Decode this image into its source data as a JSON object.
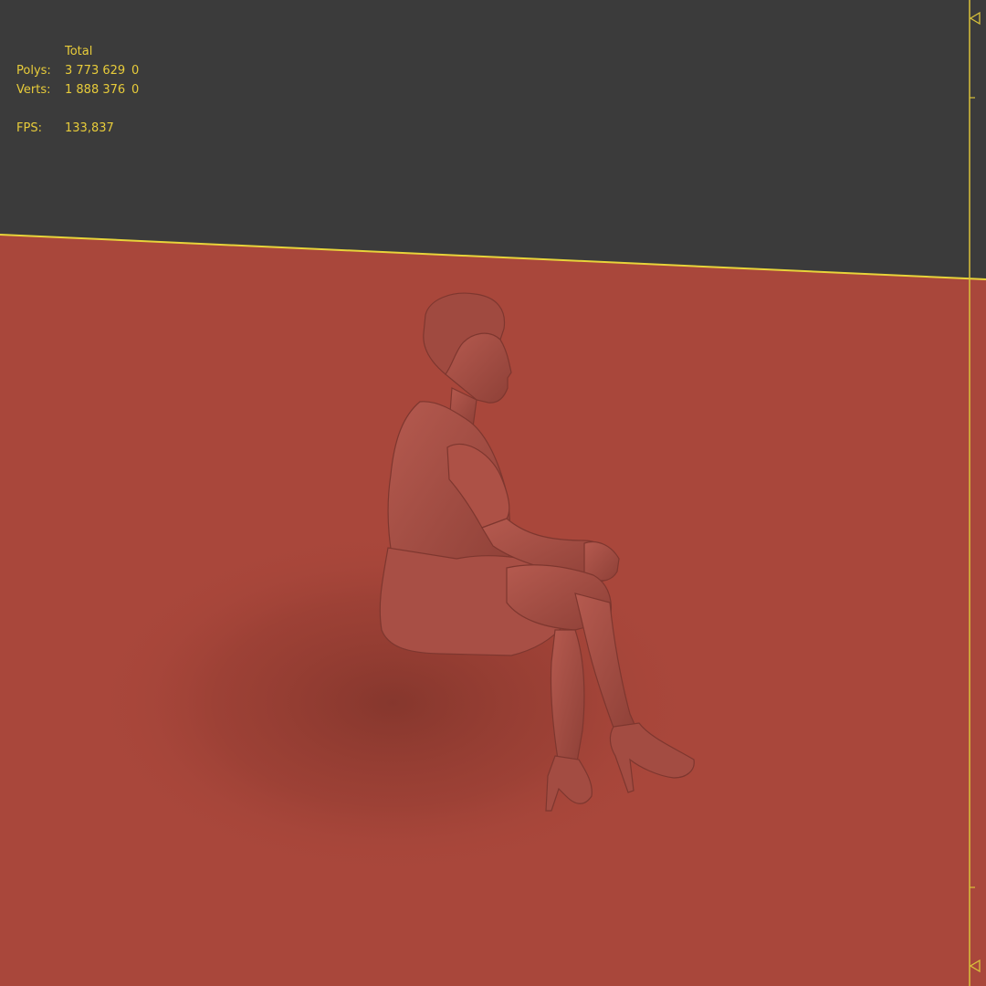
{
  "viewport": {
    "name": "Perspective viewport",
    "background_color": "#3b3b3b",
    "ground_color": "#a9473b",
    "horizon_color": "#e8d43a",
    "model_color": "#9c4a40",
    "model": "seated woman figure in dress with crossed legs and high heels"
  },
  "statistics": {
    "header_total": "Total",
    "polys_label": "Polys:",
    "polys_total": "3 773 629",
    "polys_selected": "0",
    "verts_label": "Verts:",
    "verts_total": "1 888 376",
    "verts_selected": "0",
    "fps_label": "FPS:",
    "fps_value": "133,837"
  },
  "timeline_ruler": {
    "top_marker": "triangle-marker-icon",
    "bottom_marker": "triangle-marker-icon"
  }
}
